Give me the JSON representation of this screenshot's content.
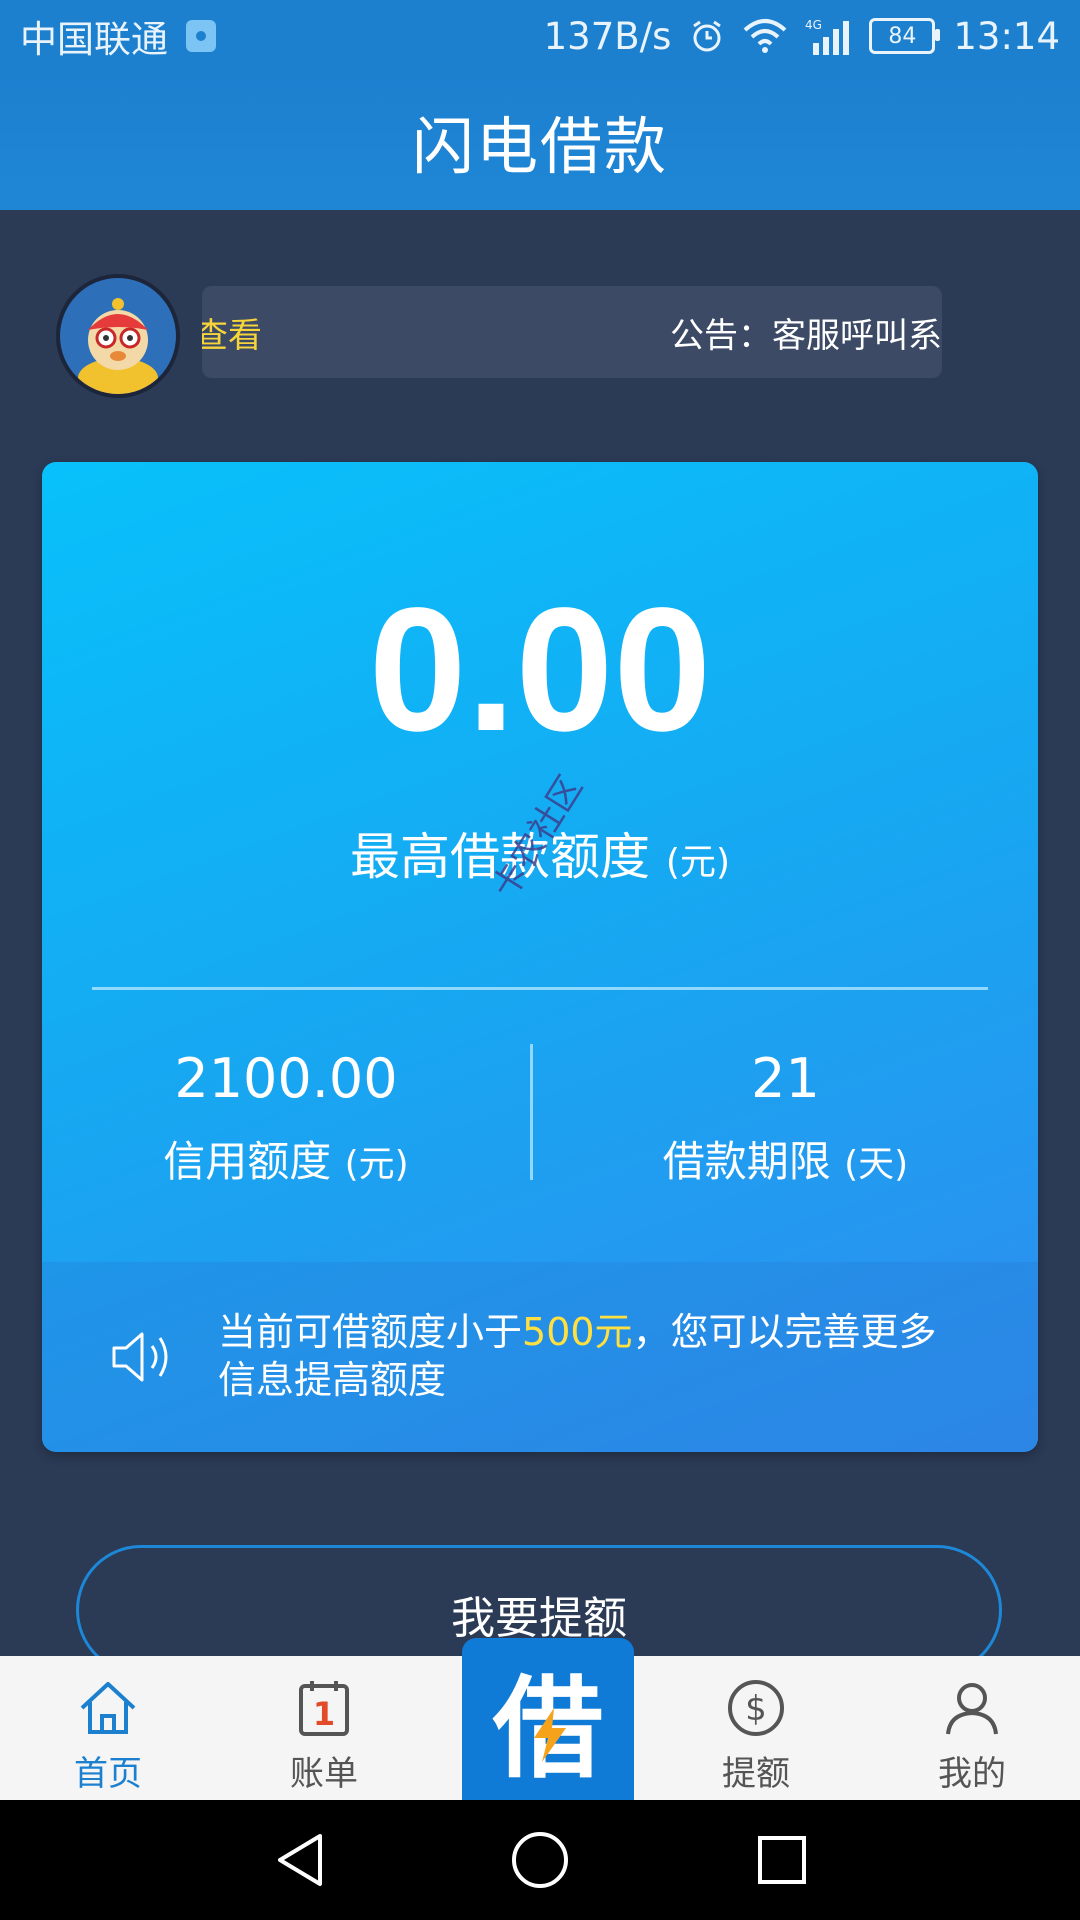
{
  "status_bar": {
    "carrier": "中国联通",
    "net_speed": "137B/s",
    "network": "4G",
    "battery": "84",
    "time": "13:14"
  },
  "header": {
    "title": "闪电借款"
  },
  "notice": {
    "scroll_left": "查看",
    "scroll_right": "公告：客服呼叫系"
  },
  "card": {
    "max_amount": "0.00",
    "max_label": "最高借款额度",
    "max_unit": "(元)",
    "credit_value": "2100.00",
    "credit_label": "信用额度",
    "credit_unit": "(元)",
    "term_value": "21",
    "term_label": "借款期限",
    "term_unit": "(天)",
    "tip_pre": "当前可借额度小于",
    "tip_highlight": "500元",
    "tip_post": "，您可以完善更多信息提高额度"
  },
  "raise_button": "我要提额",
  "watermark": "卡农社区",
  "bottom_nav": {
    "items": [
      {
        "label": "首页",
        "icon": "home-icon"
      },
      {
        "label": "账单",
        "icon": "calendar-icon",
        "badge": "1"
      },
      {
        "label": "借",
        "icon": "lightning-icon"
      },
      {
        "label": "提额",
        "icon": "dollar-icon"
      },
      {
        "label": "我的",
        "icon": "user-icon"
      }
    ]
  },
  "colors": {
    "header_blue": "#1d80cf",
    "page_bg": "#2b3a55",
    "highlight_yellow": "#ffe040",
    "card_blue": "#17a7f1"
  }
}
